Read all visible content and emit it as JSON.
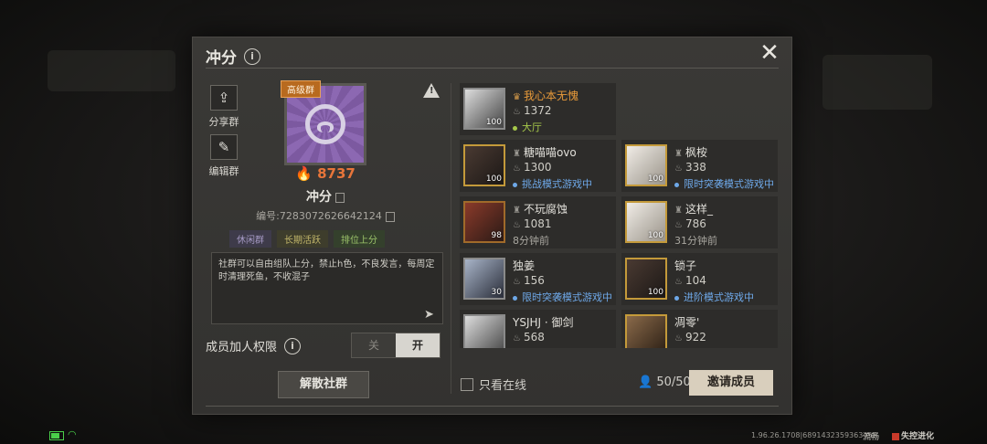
{
  "dialog": {
    "title": "冲分",
    "close_glyph": "✕"
  },
  "sidebar_actions": [
    {
      "label": "分享群",
      "icon": "share-icon"
    },
    {
      "label": "编辑群",
      "icon": "edit-icon"
    }
  ],
  "clan": {
    "grade_badge": "高级群",
    "heat": "8737",
    "name": "冲分",
    "id_text": "编号:7283072626642124",
    "tags": [
      "休闲群",
      "长期活跃",
      "排位上分"
    ],
    "description": "社群可以自由组队上分，禁止h色，不良发言，每周定时清理死鱼，不收混子"
  },
  "permission": {
    "label": "成员加人权限",
    "off_label": "关",
    "on_label": "开",
    "selected": "开"
  },
  "dissolve_button": "解散社群",
  "members": [
    {
      "name": "我心本无愧",
      "score": "1372",
      "status": "大厅",
      "status_type": "green",
      "level": "100",
      "owner": true
    },
    {
      "name": "糖喵喵ovo",
      "score": "1300",
      "status": "挑战模式游戏中",
      "status_type": "blue",
      "level": "100"
    },
    {
      "name": "枫桉",
      "score": "338",
      "status": "限时突袭模式游戏中",
      "status_type": "blue",
      "level": "100"
    },
    {
      "name": "不玩腐蚀",
      "score": "1081",
      "status": "8分钟前",
      "status_type": "gray",
      "level": "98"
    },
    {
      "name": "这样_",
      "score": "786",
      "status": "31分钟前",
      "status_type": "gray",
      "level": "100"
    },
    {
      "name": "独姜",
      "score": "156",
      "status": "限时突袭模式游戏中",
      "status_type": "blue",
      "level": "30"
    },
    {
      "name": "锁子",
      "score": "104",
      "status": "进阶模式游戏中",
      "status_type": "blue",
      "level": "100"
    },
    {
      "name": "YSJHJ · 御剑",
      "score": "568",
      "status": "",
      "status_type": "gray",
      "level": ""
    },
    {
      "name": "凋零'",
      "score": "922",
      "status": "",
      "status_type": "gray",
      "level": ""
    }
  ],
  "footer": {
    "online_only_label": "只看在线",
    "member_count": "50/50",
    "invite_button": "邀请成员"
  },
  "status_bar": {
    "version": "1.96.26.1708|689143235936345?",
    "network": "流畅",
    "brand": "失控进化"
  },
  "colors": {
    "accent_orange": "#e8753a",
    "online_blue": "#6ea8e8",
    "lobby_green": "#a6c84a"
  }
}
